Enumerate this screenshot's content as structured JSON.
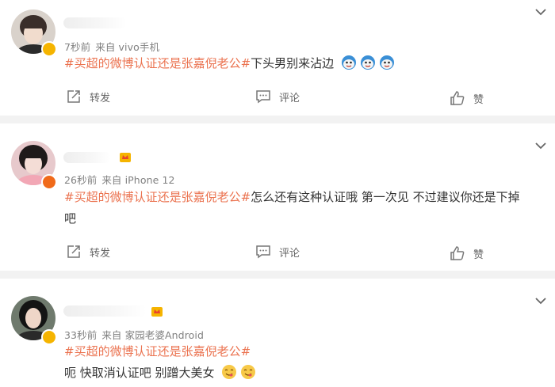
{
  "posts": [
    {
      "time": "7秒前",
      "source": "来自 vivo手机",
      "topic": "#买超的微博认证还是张嘉倪老公#",
      "text": "下头男别来沾边",
      "text_line2": "",
      "emoji_icon": "blue-cartoon-face-icon",
      "badge_color": "#f5b400"
    },
    {
      "time": "26秒前",
      "source": "来自 iPhone 12",
      "topic": "#买超的微博认证还是张嘉倪老公#",
      "text": "怎么还有这种认证哦 第一次见 不过建议你还是下掉",
      "text_line2": "吧",
      "emoji_icon": "",
      "badge_color": "#f06a1a"
    },
    {
      "time": "33秒前",
      "source": "来自 家园老婆Android",
      "topic": "#买超的微博认证还是张嘉倪老公#",
      "text": "呃 快取消认证吧 别蹭大美女",
      "text_line2": "",
      "emoji_icon": "yum-face-icon",
      "badge_color": "#f5b400"
    }
  ],
  "actions": {
    "repost_label": "转发",
    "comment_label": "评论",
    "like_label": "赞"
  },
  "colors": {
    "topic": "#eb7350",
    "meta": "#808080",
    "divider": "#f2f2f2"
  }
}
